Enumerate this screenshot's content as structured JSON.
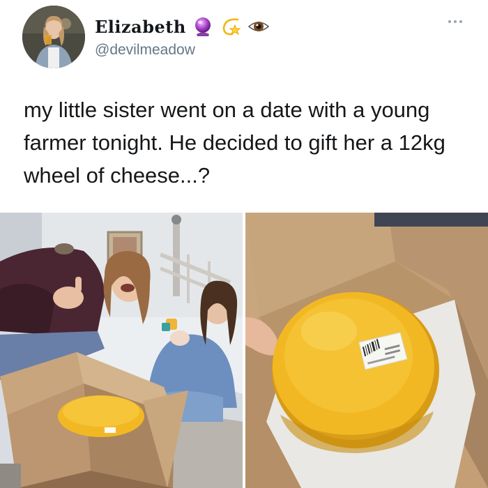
{
  "tweet": {
    "author": {
      "display_name": "Elizabeth",
      "handle": "@devilmeadow",
      "name_emojis": [
        "crystal-ball-icon",
        "dizzy-star-icon",
        "eye-icon"
      ]
    },
    "text": "my little sister went on a date with a young farmer tonight. He decided to gift her a 12kg wheel of cheese...?",
    "more_menu_icon": "more-dots-icon",
    "media": [
      {
        "name": "photo-sisters-with-cheese-box"
      },
      {
        "name": "photo-cheese-wheel-in-box"
      }
    ]
  },
  "colors": {
    "text": "#14171a",
    "handle": "#657786",
    "cheese": "#f2b824",
    "cardboard": "#c9a77e"
  }
}
